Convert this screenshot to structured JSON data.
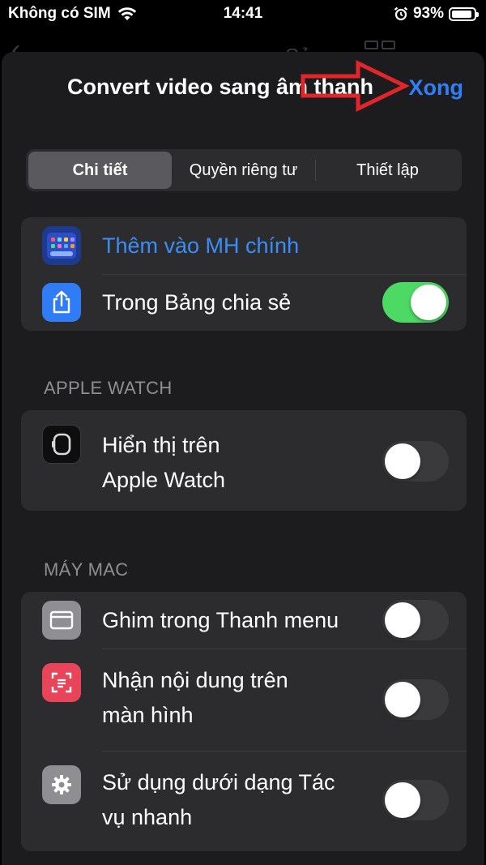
{
  "status_bar": {
    "carrier": "Không có SIM",
    "time": "14:41",
    "battery_percent": "93%",
    "battery_level": 0.93,
    "icons": [
      "wifi-icon",
      "alarm-icon",
      "battery-icon"
    ]
  },
  "background_nav": {
    "edit_label": "Sửa"
  },
  "sheet": {
    "title": "Convert video sang âm thanh",
    "done_label": "Xong"
  },
  "segments": [
    {
      "label": "Chi tiết",
      "active": true
    },
    {
      "label": "Quyền riêng tư",
      "active": false
    },
    {
      "label": "Thiết lập",
      "active": false
    }
  ],
  "group_main": {
    "rows": [
      {
        "label": "Thêm vào MH chính",
        "icon": "home-screen-icon"
      },
      {
        "label": "Trong Bảng chia sẻ",
        "icon": "share-icon",
        "toggle_on": true
      }
    ]
  },
  "apple_watch": {
    "header": "APPLE WATCH",
    "row": {
      "line1": "Hiển thị trên",
      "line2": "Apple Watch",
      "icon": "watch-icon",
      "toggle_on": false
    }
  },
  "mac": {
    "header": "MÁY MAC",
    "rows": [
      {
        "line1": "Ghim trong Thanh menu",
        "line2": "",
        "icon": "menu-bar-icon",
        "toggle_on": false
      },
      {
        "line1": "Nhận nội dung trên",
        "line2": "màn hình",
        "icon": "screen-capture-icon",
        "toggle_on": false
      },
      {
        "line1": "Sử dụng dưới dạng Tác",
        "line2": "vụ nhanh",
        "icon": "gear-icon",
        "toggle_on": false
      }
    ]
  },
  "colors": {
    "accent_blue": "#2f80f8",
    "toggle_on": "#4cd964",
    "arrow_red": "#e0262b"
  }
}
